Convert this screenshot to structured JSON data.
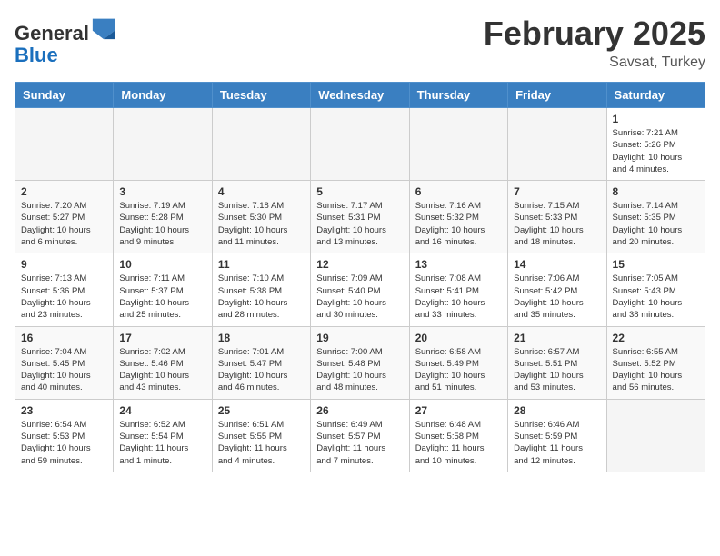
{
  "header": {
    "logo_general": "General",
    "logo_blue": "Blue",
    "month_title": "February 2025",
    "location": "Savsat, Turkey"
  },
  "days_of_week": [
    "Sunday",
    "Monday",
    "Tuesday",
    "Wednesday",
    "Thursday",
    "Friday",
    "Saturday"
  ],
  "weeks": [
    [
      {
        "day": "",
        "empty": true
      },
      {
        "day": "",
        "empty": true
      },
      {
        "day": "",
        "empty": true
      },
      {
        "day": "",
        "empty": true
      },
      {
        "day": "",
        "empty": true
      },
      {
        "day": "",
        "empty": true
      },
      {
        "day": "1",
        "info": "Sunrise: 7:21 AM\nSunset: 5:26 PM\nDaylight: 10 hours\nand 4 minutes."
      }
    ],
    [
      {
        "day": "2",
        "info": "Sunrise: 7:20 AM\nSunset: 5:27 PM\nDaylight: 10 hours\nand 6 minutes."
      },
      {
        "day": "3",
        "info": "Sunrise: 7:19 AM\nSunset: 5:28 PM\nDaylight: 10 hours\nand 9 minutes."
      },
      {
        "day": "4",
        "info": "Sunrise: 7:18 AM\nSunset: 5:30 PM\nDaylight: 10 hours\nand 11 minutes."
      },
      {
        "day": "5",
        "info": "Sunrise: 7:17 AM\nSunset: 5:31 PM\nDaylight: 10 hours\nand 13 minutes."
      },
      {
        "day": "6",
        "info": "Sunrise: 7:16 AM\nSunset: 5:32 PM\nDaylight: 10 hours\nand 16 minutes."
      },
      {
        "day": "7",
        "info": "Sunrise: 7:15 AM\nSunset: 5:33 PM\nDaylight: 10 hours\nand 18 minutes."
      },
      {
        "day": "8",
        "info": "Sunrise: 7:14 AM\nSunset: 5:35 PM\nDaylight: 10 hours\nand 20 minutes."
      }
    ],
    [
      {
        "day": "9",
        "info": "Sunrise: 7:13 AM\nSunset: 5:36 PM\nDaylight: 10 hours\nand 23 minutes."
      },
      {
        "day": "10",
        "info": "Sunrise: 7:11 AM\nSunset: 5:37 PM\nDaylight: 10 hours\nand 25 minutes."
      },
      {
        "day": "11",
        "info": "Sunrise: 7:10 AM\nSunset: 5:38 PM\nDaylight: 10 hours\nand 28 minutes."
      },
      {
        "day": "12",
        "info": "Sunrise: 7:09 AM\nSunset: 5:40 PM\nDaylight: 10 hours\nand 30 minutes."
      },
      {
        "day": "13",
        "info": "Sunrise: 7:08 AM\nSunset: 5:41 PM\nDaylight: 10 hours\nand 33 minutes."
      },
      {
        "day": "14",
        "info": "Sunrise: 7:06 AM\nSunset: 5:42 PM\nDaylight: 10 hours\nand 35 minutes."
      },
      {
        "day": "15",
        "info": "Sunrise: 7:05 AM\nSunset: 5:43 PM\nDaylight: 10 hours\nand 38 minutes."
      }
    ],
    [
      {
        "day": "16",
        "info": "Sunrise: 7:04 AM\nSunset: 5:45 PM\nDaylight: 10 hours\nand 40 minutes."
      },
      {
        "day": "17",
        "info": "Sunrise: 7:02 AM\nSunset: 5:46 PM\nDaylight: 10 hours\nand 43 minutes."
      },
      {
        "day": "18",
        "info": "Sunrise: 7:01 AM\nSunset: 5:47 PM\nDaylight: 10 hours\nand 46 minutes."
      },
      {
        "day": "19",
        "info": "Sunrise: 7:00 AM\nSunset: 5:48 PM\nDaylight: 10 hours\nand 48 minutes."
      },
      {
        "day": "20",
        "info": "Sunrise: 6:58 AM\nSunset: 5:49 PM\nDaylight: 10 hours\nand 51 minutes."
      },
      {
        "day": "21",
        "info": "Sunrise: 6:57 AM\nSunset: 5:51 PM\nDaylight: 10 hours\nand 53 minutes."
      },
      {
        "day": "22",
        "info": "Sunrise: 6:55 AM\nSunset: 5:52 PM\nDaylight: 10 hours\nand 56 minutes."
      }
    ],
    [
      {
        "day": "23",
        "info": "Sunrise: 6:54 AM\nSunset: 5:53 PM\nDaylight: 10 hours\nand 59 minutes."
      },
      {
        "day": "24",
        "info": "Sunrise: 6:52 AM\nSunset: 5:54 PM\nDaylight: 11 hours\nand 1 minute."
      },
      {
        "day": "25",
        "info": "Sunrise: 6:51 AM\nSunset: 5:55 PM\nDaylight: 11 hours\nand 4 minutes."
      },
      {
        "day": "26",
        "info": "Sunrise: 6:49 AM\nSunset: 5:57 PM\nDaylight: 11 hours\nand 7 minutes."
      },
      {
        "day": "27",
        "info": "Sunrise: 6:48 AM\nSunset: 5:58 PM\nDaylight: 11 hours\nand 10 minutes."
      },
      {
        "day": "28",
        "info": "Sunrise: 6:46 AM\nSunset: 5:59 PM\nDaylight: 11 hours\nand 12 minutes."
      },
      {
        "day": "",
        "empty": true
      }
    ]
  ]
}
